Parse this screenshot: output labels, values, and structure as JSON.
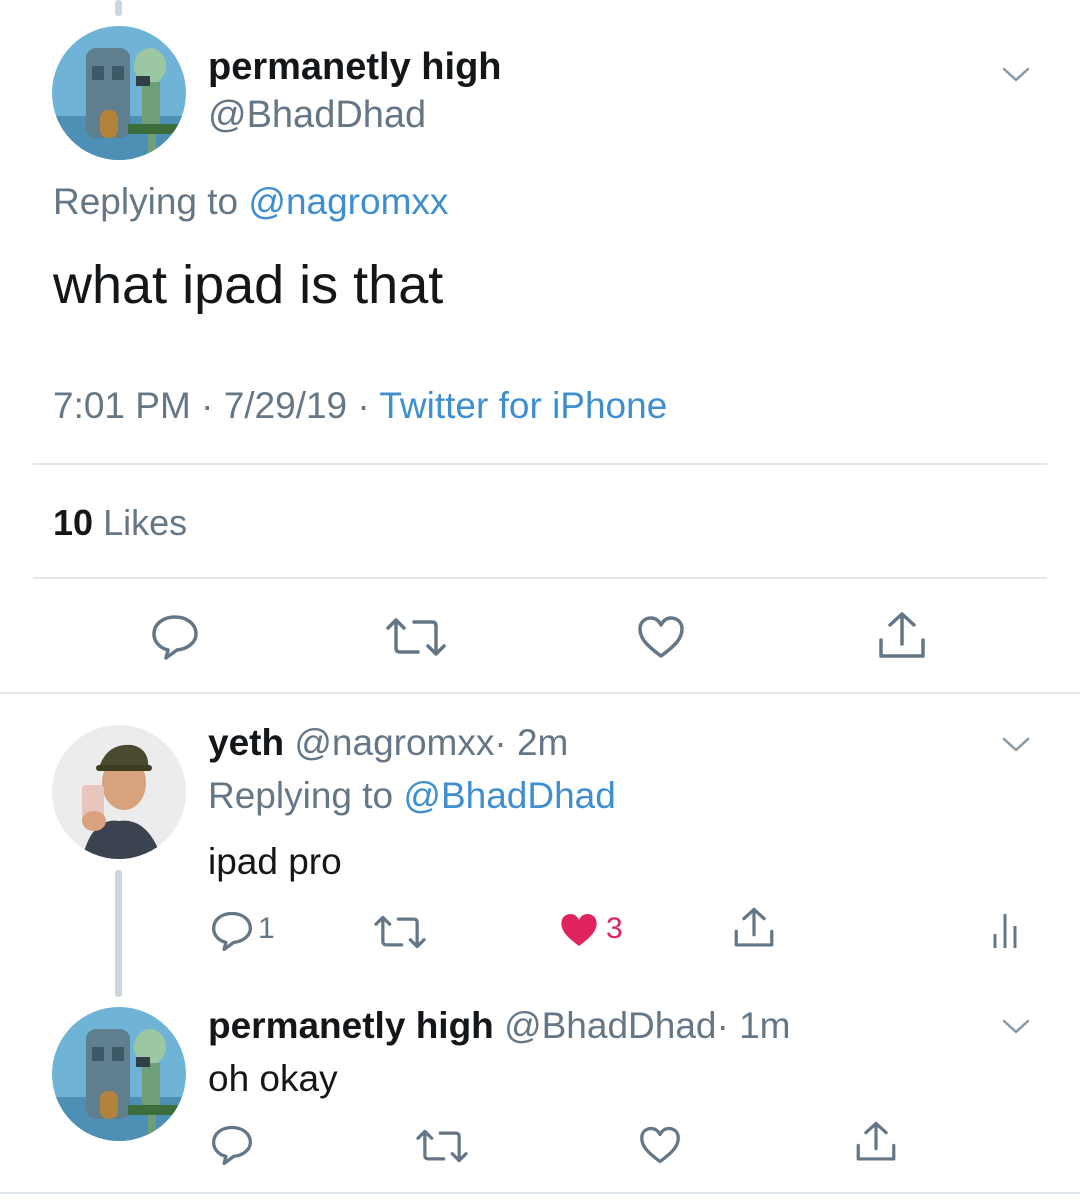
{
  "main_tweet": {
    "display_name": "permanetly high",
    "handle": "@BhadDhad",
    "replying_prefix": "Replying to",
    "replying_handle": "@nagromxx",
    "text": "what ipad is that",
    "time": "7:01 PM",
    "date": "7/29/19",
    "separator": "·",
    "source": "Twitter for iPhone",
    "likes_count": "10",
    "likes_label": "Likes"
  },
  "reply_1": {
    "display_name": "yeth",
    "handle": "@nagromxx",
    "separator": "·",
    "age": "2m",
    "replying_prefix": "Replying to",
    "replying_handle": "@BhadDhad",
    "text": "ipad pro",
    "reply_count": "1",
    "like_count": "3"
  },
  "reply_2": {
    "display_name": "permanetly high",
    "handle": "@BhadDhad",
    "separator": "·",
    "age": "1m",
    "text": "oh okay"
  },
  "colors": {
    "text": "#14171a",
    "muted": "#657786",
    "link": "#3f8fd0",
    "liked": "#e0245e",
    "divider": "#e1e8ed"
  },
  "icons": [
    "reply-icon",
    "retweet-icon",
    "like-icon",
    "share-icon",
    "analytics-icon",
    "chevron-down-icon"
  ]
}
